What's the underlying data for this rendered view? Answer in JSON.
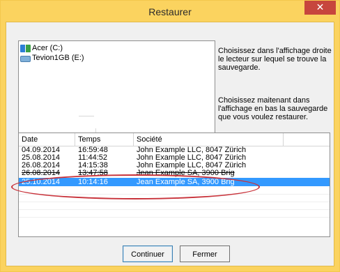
{
  "window": {
    "title": "Restaurer",
    "close_glyph": "✕"
  },
  "drives": [
    {
      "label": "Acer (C:)",
      "icon": "windows-drive-icon"
    },
    {
      "label": "Tevion1GB (E:)",
      "icon": "usb-drive-icon"
    }
  ],
  "instructions": {
    "p1": "Choisissez dans l'affichage droite le lecteur sur lequel se trouve la sauvegarde.",
    "p2": "Choisissez maitenant dans l'affichage en bas la sauvegarde que vous voulez restaurer."
  },
  "table": {
    "columns": [
      "Date",
      "Temps",
      "Société",
      ""
    ],
    "rows": [
      {
        "date": "04.09.2014",
        "time": "16:59:48",
        "company": "John Example LLC, 8047 Zürich",
        "selected": false
      },
      {
        "date": "25.08.2014",
        "time": "11:44:52",
        "company": "John Example LLC, 8047 Zürich",
        "selected": false
      },
      {
        "date": "26.08.2014",
        "time": "14:15:38",
        "company": "John Example LLC, 8047 Zürich",
        "selected": false
      },
      {
        "date": "26.08.2014",
        "time": "13:47:58",
        "company": "Jean Example SA, 3900 Brig",
        "selected": false
      },
      {
        "date": "25.10.2014",
        "time": "10:14:16",
        "company": "Jean Example SA, 3900 Brig",
        "selected": true
      }
    ]
  },
  "buttons": {
    "continue": "Continuer",
    "close": "Fermer"
  },
  "colors": {
    "titlebar": "#fbd35f",
    "selection": "#3399ff",
    "close": "#c7463d",
    "annotation": "#c8323a"
  }
}
